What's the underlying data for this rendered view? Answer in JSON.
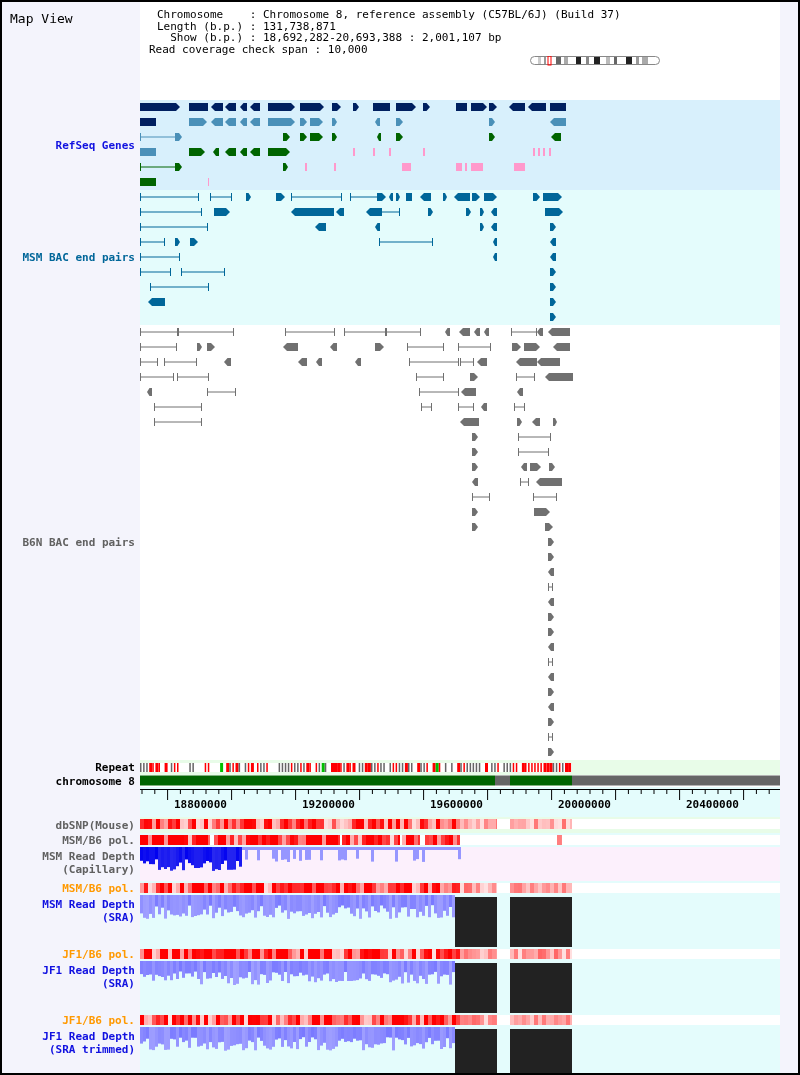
{
  "title": "Map View",
  "header": [
    "Chromosome    : Chromosome 8, reference assembly (C57BL/6J) (Build 37)",
    "Length (b.p.) : 131,738,871",
    "  Show (b.p.) : 18,692,282-20,693,388 : 2,001,107 bp",
    "Read coverage check span : 10,000"
  ],
  "tracks": [
    {
      "kind": "genes",
      "label": [
        "RefSeq Genes"
      ],
      "color": "#1010e0"
    },
    {
      "kind": "bac_msm",
      "label": [
        "MSM BAC end pairs"
      ],
      "color": "#006699"
    },
    {
      "kind": "bac_b6n",
      "label": [
        "B6N BAC end pairs"
      ],
      "color": "#606060"
    },
    {
      "kind": "repeat",
      "label": [
        "Repeat"
      ],
      "color": "#000000"
    },
    {
      "kind": "chromosome",
      "label": [
        "chromosome 8"
      ],
      "color": "#000000"
    },
    {
      "kind": "axis",
      "ticks": [
        "18800000",
        "19200000",
        "19600000",
        "20000000",
        "20400000"
      ]
    },
    {
      "kind": "snp",
      "label": [
        "dbSNP(Mouse)"
      ],
      "color": "#606060"
    },
    {
      "kind": "pol",
      "label": [
        "MSM/B6 pol."
      ],
      "color": "#606060"
    },
    {
      "kind": "capillary",
      "label": [
        "MSM Read Depth",
        "(Capillary)"
      ],
      "color": "#606060"
    },
    {
      "kind": "pol",
      "label": [
        "MSM/B6 pol."
      ],
      "color": "#ff9900"
    },
    {
      "kind": "sra",
      "label": [
        "MSM Read Depth",
        "(SRA)"
      ],
      "color": "#1010e0"
    },
    {
      "kind": "pol",
      "label": [
        "JF1/B6 pol."
      ],
      "color": "#ff9900"
    },
    {
      "kind": "sra",
      "label": [
        "JF1 Read Depth",
        "(SRA)"
      ],
      "color": "#1010e0"
    },
    {
      "kind": "pol",
      "label": [
        "JF1/B6 pol."
      ],
      "color": "#ff9900"
    },
    {
      "kind": "sra",
      "label": [
        "JF1 Read Depth",
        "(SRA trimmed)"
      ],
      "color": "#1010e0"
    }
  ]
}
